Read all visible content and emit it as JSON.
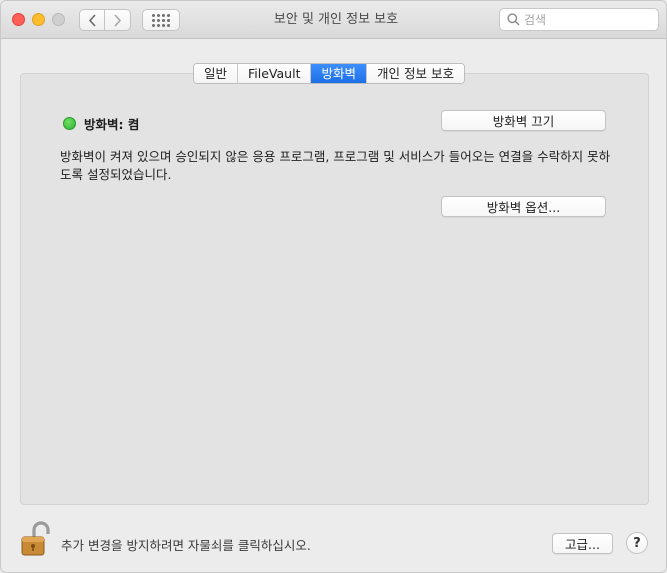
{
  "window": {
    "title": "보안 및 개인 정보 보호"
  },
  "search": {
    "placeholder": "검색"
  },
  "tabs": [
    {
      "label": "일반",
      "active": false
    },
    {
      "label": "FileVault",
      "active": false
    },
    {
      "label": "방화벽",
      "active": true
    },
    {
      "label": "개인 정보 보호",
      "active": false
    }
  ],
  "firewall": {
    "status_label": "방화벽: 켬",
    "status_color": "#34c22f",
    "toggle_button": "방화벽 끄기",
    "description": "방화벽이 켜져 있으며 승인되지 않은 응용 프로그램, 프로그램 및 서비스가 들어오는 연결을 수락하지 못하도록 설정되었습니다.",
    "options_button": "방화벽 옵션..."
  },
  "footer": {
    "lock_text": "추가 변경을 방지하려면 자물쇠를 클릭하십시오.",
    "advanced_button": "고급...",
    "help_button": "?"
  },
  "icons": {
    "close": "close-icon",
    "minimize": "minimize-icon",
    "zoom": "zoom-icon",
    "back": "chevron-left-icon",
    "forward": "chevron-right-icon",
    "show_all": "grid-icon",
    "search": "search-icon",
    "lock": "lock-open-icon"
  }
}
